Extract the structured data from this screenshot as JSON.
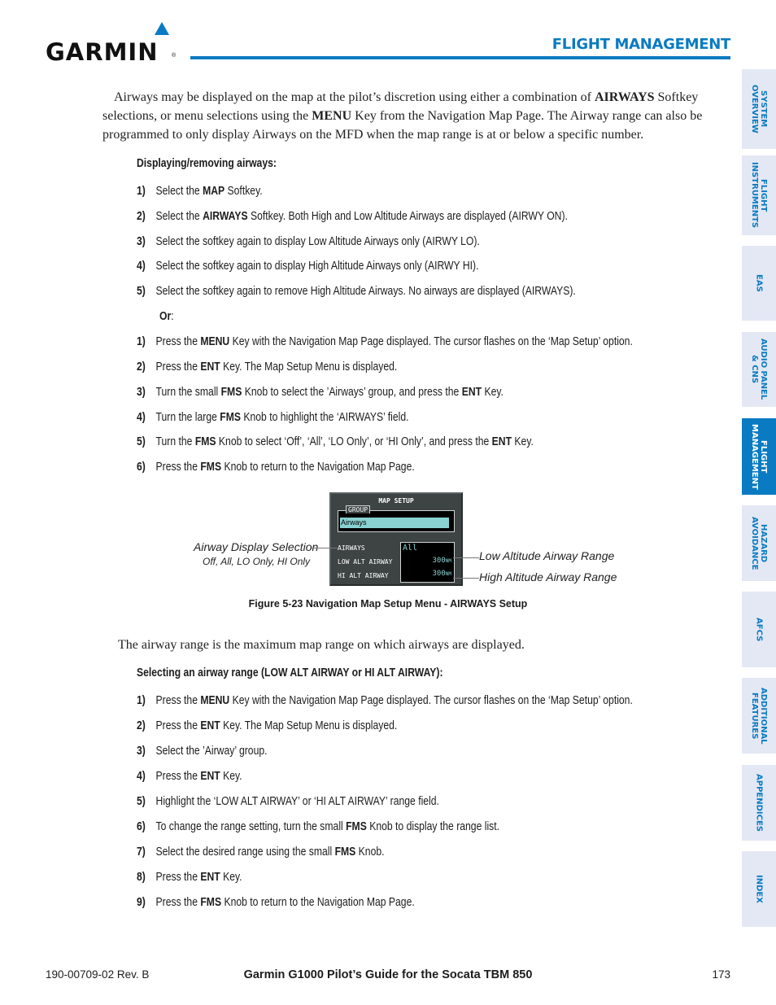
{
  "header": {
    "logo_text": "GARMIN",
    "logo_reg": "®",
    "section_title": "FLIGHT MANAGEMENT",
    "brand_color": "#0a7bc2"
  },
  "side_tabs": [
    {
      "label": "SYSTEM\nOVERVIEW",
      "active": false
    },
    {
      "label": "FLIGHT\nINSTRUMENTS",
      "active": false
    },
    {
      "label": "EAS",
      "active": false
    },
    {
      "label": "AUDIO PANEL\n& CNS",
      "active": false
    },
    {
      "label": "FLIGHT\nMANAGEMENT",
      "active": true
    },
    {
      "label": "HAZARD\nAVOIDANCE",
      "active": false
    },
    {
      "label": "AFCS",
      "active": false
    },
    {
      "label": "ADDITIONAL\nFEATURES",
      "active": false
    },
    {
      "label": "APPENDICES",
      "active": false
    },
    {
      "label": "INDEX",
      "active": false
    }
  ],
  "intro": {
    "part1": "Airways may be displayed on the map at the pilot’s discretion using either a combination of ",
    "bold1": "AIRWAYS",
    "part2": " Softkey selections, or menu selections using the ",
    "bold2": "MENU",
    "part3": " Key from the Navigation Map Page.  The Airway range can also be programmed to only display Airways on the MFD when the map range is at or below a specific number."
  },
  "section1": {
    "heading": "Displaying/removing airways:",
    "steps_a": [
      {
        "num": "1)",
        "pre": "Select the ",
        "bold": "MAP",
        "post": " Softkey."
      },
      {
        "num": "2)",
        "pre": "Select the ",
        "bold": "AIRWAYS",
        "post": " Softkey. Both High and Low Altitude Airways are displayed (AIRWY ON)."
      },
      {
        "num": "3)",
        "pre": "Select the softkey again to display Low Altitude Airways only (AIRWY LO).",
        "bold": "",
        "post": ""
      },
      {
        "num": "4)",
        "pre": "Select the softkey again to display High Altitude Airways only (AIRWY HI).",
        "bold": "",
        "post": ""
      },
      {
        "num": "5)",
        "pre": "Select the softkey again to remove High Altitude Airways. No airways are displayed (AIRWAYS).",
        "bold": "",
        "post": ""
      }
    ],
    "or_label": "Or",
    "or_colon": ":",
    "steps_b": [
      {
        "num": "1)",
        "pre": "Press the ",
        "bold": "MENU",
        "post": " Key with the Navigation Map Page displayed.  The cursor flashes on the ‘Map Setup’ option."
      },
      {
        "num": "2)",
        "pre": "Press the ",
        "bold": "ENT",
        "post": " Key.  The Map Setup Menu is displayed."
      },
      {
        "num": "3)",
        "pre": "Turn the small ",
        "bold": "FMS",
        "post": " Knob to select the ’Airways’ group, and press the ",
        "bold2": "ENT",
        "post2": " Key."
      },
      {
        "num": "4)",
        "pre": "Turn the large ",
        "bold": "FMS",
        "post": " Knob to highlight the ‘AIRWAYS’ field."
      },
      {
        "num": "5)",
        "pre": "Turn the ",
        "bold": "FMS",
        "post": " Knob to select ‘Off’, ‘All’, ‘LO Only’, or ‘HI Only’, and press the ",
        "bold2": "ENT",
        "post2": " Key."
      },
      {
        "num": "6)",
        "pre": "Press the ",
        "bold": "FMS",
        "post": " Knob to return to the Navigation Map Page."
      }
    ]
  },
  "figure": {
    "screen": {
      "title": "MAP SETUP",
      "group_label": "GROUP",
      "group_value": "Airways",
      "rows": [
        "AIRWAYS",
        "LOW ALT AIRWAY",
        "HI ALT AIRWAY"
      ],
      "airways_value": "All",
      "low_alt_value": "300",
      "hi_alt_value": "300",
      "unit": "NM"
    },
    "callouts": {
      "left_title": "Airway Display Selection",
      "left_sub": "Off, All, LO Only, HI Only",
      "right_low": "Low Altitude Airway Range",
      "right_high": "High Altitude Airway Range"
    },
    "caption": "Figure 5-23  Navigation Map Setup Menu - AIRWAYS Setup"
  },
  "range_text": "The airway range is the maximum map range on which airways are displayed.",
  "section2": {
    "heading": "Selecting an airway range (LOW ALT AIRWAY or HI ALT AIRWAY):",
    "steps": [
      {
        "num": "1)",
        "pre": "Press the ",
        "bold": "MENU",
        "post": " Key with the Navigation Map Page displayed.  The cursor flashes on the ‘Map Setup’ option."
      },
      {
        "num": "2)",
        "pre": "Press the ",
        "bold": "ENT",
        "post": " Key.  The Map Setup Menu is displayed."
      },
      {
        "num": "3)",
        "pre": "Select the ’Airway’ group.",
        "bold": "",
        "post": ""
      },
      {
        "num": "4)",
        "pre": "Press the ",
        "bold": "ENT",
        "post": " Key."
      },
      {
        "num": "5)",
        "pre": "Highlight the ‘LOW ALT AIRWAY’ or ‘HI ALT AIRWAY’ range field.",
        "bold": "",
        "post": ""
      },
      {
        "num": "6)",
        "pre": "To change the range setting, turn the small ",
        "bold": "FMS",
        "post": " Knob to display the range list."
      },
      {
        "num": "7)",
        "pre": "Select the desired range using the small ",
        "bold": "FMS",
        "post": " Knob."
      },
      {
        "num": "8)",
        "pre": "Press the ",
        "bold": "ENT",
        "post": " Key."
      },
      {
        "num": "9)",
        "pre": "Press the ",
        "bold": "FMS",
        "post": " Knob to return to the Navigation Map Page."
      }
    ]
  },
  "footer": {
    "doc_number": "190-00709-02  Rev. B",
    "title": "Garmin G1000 Pilot’s Guide for the Socata TBM 850",
    "page_number": "173"
  }
}
